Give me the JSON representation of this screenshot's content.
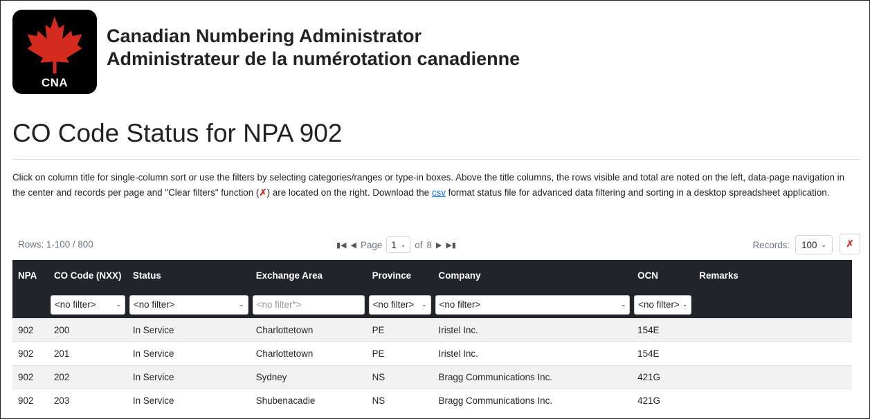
{
  "header": {
    "logo_text": "CNA",
    "title_en": "Canadian Numbering Administrator",
    "title_fr": "Administrateur de la numérotation canadienne"
  },
  "page": {
    "title": "CO Code Status for NPA 902",
    "intro_part1": "Click on column title for single-column sort or use the filters by selecting categories/ranges or type-in boxes. Above the title columns, the rows visible and total are noted on the left, data-page navigation in the center and records per page and \"Clear filters\" function (",
    "intro_part2": ") are located on the right. Download the ",
    "csv_link": "csv",
    "intro_part3": " format status file for advanced data filtering and sorting in a desktop spreadsheet application."
  },
  "toolbar": {
    "rows_info": "Rows: 1-100 / 800",
    "page_label": "Page",
    "page_value": "1",
    "of_label": "of",
    "page_total": "8",
    "records_label": "Records:",
    "records_value": "100"
  },
  "table": {
    "headers": {
      "npa": "NPA",
      "co_code": "CO Code (NXX)",
      "status": "Status",
      "exchange_area": "Exchange Area",
      "province": "Province",
      "company": "Company",
      "ocn": "OCN",
      "remarks": "Remarks"
    },
    "filters": {
      "co_code": "<no filter>",
      "status": "<no filter>",
      "exchange_area_placeholder": "<no filter*>",
      "province": "<no filter>",
      "company": "<no filter>",
      "ocn": "<no filter>"
    },
    "rows": [
      {
        "npa": "902",
        "co_code": "200",
        "status": "In Service",
        "exchange_area": "Charlottetown",
        "province": "PE",
        "company": "Iristel Inc.",
        "ocn": "154E",
        "remarks": ""
      },
      {
        "npa": "902",
        "co_code": "201",
        "status": "In Service",
        "exchange_area": "Charlottetown",
        "province": "PE",
        "company": "Iristel Inc.",
        "ocn": "154E",
        "remarks": ""
      },
      {
        "npa": "902",
        "co_code": "202",
        "status": "In Service",
        "exchange_area": "Sydney",
        "province": "NS",
        "company": "Bragg Communications Inc.",
        "ocn": "421G",
        "remarks": ""
      },
      {
        "npa": "902",
        "co_code": "203",
        "status": "In Service",
        "exchange_area": "Shubenacadie",
        "province": "NS",
        "company": "Bragg Communications Inc.",
        "ocn": "421G",
        "remarks": ""
      }
    ]
  },
  "colors": {
    "header_bg": "#212529",
    "logo_bg": "#000000",
    "maple_leaf": "#d52b1e",
    "link": "#0d6efd"
  }
}
